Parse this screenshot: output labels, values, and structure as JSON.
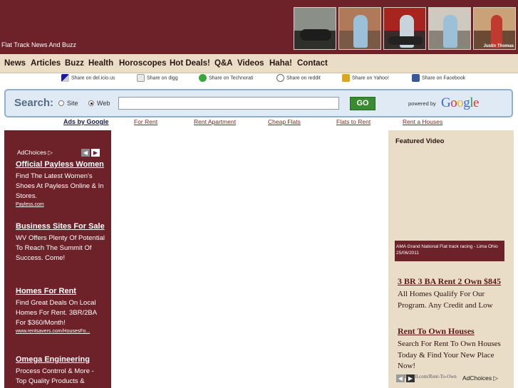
{
  "header": {
    "tagline": "Flat Track News And Buzz",
    "photo_caption": "Justin Thomas"
  },
  "nav": {
    "items": [
      "News",
      "Articles",
      "Buzz",
      "Health",
      "Horoscopes",
      "Hot Deals!",
      "Q&A",
      "Videos",
      "Haha!",
      "Contact"
    ]
  },
  "share": {
    "items": [
      {
        "label": "Share on del.icio.us",
        "icon": "delicious-icon"
      },
      {
        "label": "Share on digg",
        "icon": "digg-icon"
      },
      {
        "label": "Share on Technorati",
        "icon": "technorati-icon"
      },
      {
        "label": "Share on reddit",
        "icon": "reddit-icon"
      },
      {
        "label": "Share on Yahoo!",
        "icon": "yahoo-icon"
      },
      {
        "label": "Share on Facebook",
        "icon": "facebook-icon"
      }
    ]
  },
  "search": {
    "label": "Search:",
    "option_site": "Site",
    "option_web": "Web",
    "selected": "Web",
    "value": "",
    "go_label": "GO",
    "powered_by": "powered by",
    "google_logo": "Google"
  },
  "adlinks": {
    "title": "Ads by Google",
    "items": [
      "For Rent",
      "Rent Apartment",
      "Cheap Flats",
      "Flats to Rent",
      "Rent a Houses"
    ]
  },
  "left_ads": {
    "adchoices": "AdChoices",
    "ads": [
      {
        "title": "Official Payless Women",
        "body": "Find The Latest Women's Shoes At Payless Online & In Stores.",
        "url": "Payless.com"
      },
      {
        "title": "Business Sites For Sale",
        "body": "WV Offers Plenty Of Potential To Reach The Summit Of Success. Come!",
        "url": ""
      },
      {
        "title": "Homes For Rent",
        "body": "Find Great Deals On Local Homes For Rent. 3BR/2BA For $360/Month!",
        "url": "www.rentsavers.com/HousesFo..."
      },
      {
        "title": "Omega Engineering",
        "body": "Process Contrrol & More - Top Quality Products &",
        "url": ""
      }
    ]
  },
  "right": {
    "featured_title": "Featured Video",
    "video_caption": "AMA Grand National Flat track racing - Lima Ohio 25/06/2011",
    "ads": [
      {
        "title": "3 BR 3 BA Rent 2 Own $845",
        "body": "All Homes Qualify For Our Program. Any Credit and Low",
        "url": ""
      },
      {
        "title": "Rent To Own Houses",
        "body": "Search For Rent To Own Houses Today & Find Your New Place Now!",
        "url": "DoTellAll.com/Rent-To-Own"
      }
    ],
    "adchoices": "AdChoices"
  },
  "colors": {
    "maroon": "#6d2128",
    "tan": "#e9ddc7",
    "search_bg": "#dfeaf5",
    "go_green": "#3a8a32"
  }
}
